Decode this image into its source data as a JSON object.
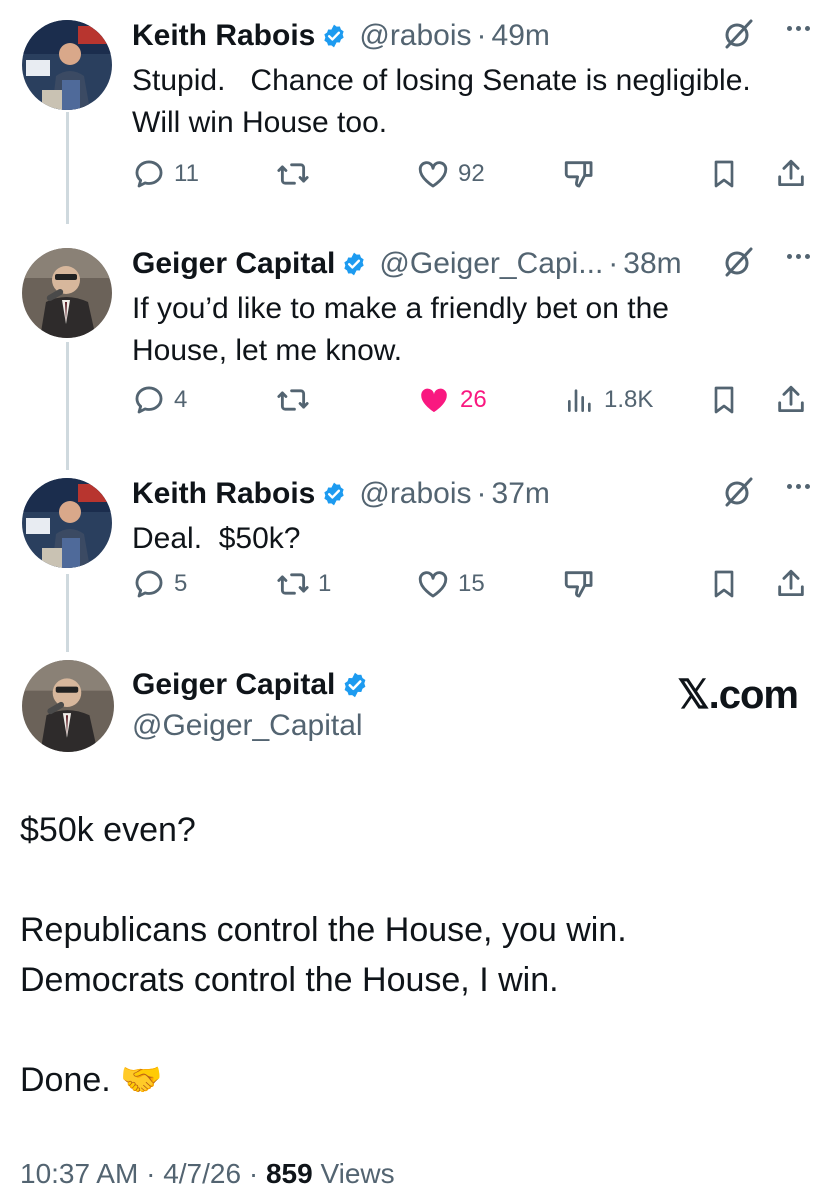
{
  "replies": [
    {
      "name": "Keith Rabois",
      "handle": "@rabois",
      "time": "49m",
      "text_lines": [
        "Stupid.   Chance of losing Senate is negligible.",
        "Will win House too."
      ],
      "replies_count": "11",
      "reposts_count": "",
      "likes_count": "92",
      "views_count": "",
      "liked": false
    },
    {
      "name": "Geiger Capital",
      "handle": "@Geiger_Capi...",
      "time": "38m",
      "text_lines": [
        "If you’d like to make a friendly bet on the",
        "House, let me know."
      ],
      "replies_count": "4",
      "reposts_count": "",
      "likes_count": "26",
      "views_count": "1.8K",
      "liked": true
    },
    {
      "name": "Keith Rabois",
      "handle": "@rabois",
      "time": "37m",
      "text_lines": [
        "Deal.  $50k?"
      ],
      "replies_count": "5",
      "reposts_count": "1",
      "likes_count": "15",
      "views_count": "",
      "liked": false
    }
  ],
  "main": {
    "name": "Geiger Capital",
    "handle": "@Geiger_Capital",
    "brand": "𝕏.com",
    "line1": "$50k even?",
    "line2": "Republicans control the House, you win.",
    "line3": "Democrats control the House, I win.",
    "line4": "Done. 🤝",
    "time": "10:37 AM",
    "date": "4/7/26",
    "views_count": "859",
    "views_label": "Views"
  },
  "separator": "·",
  "colors": {
    "verified": "#1d9bf0",
    "liked": "#f91880",
    "secondary": "#536471",
    "thread_line": "#cfd9de"
  }
}
